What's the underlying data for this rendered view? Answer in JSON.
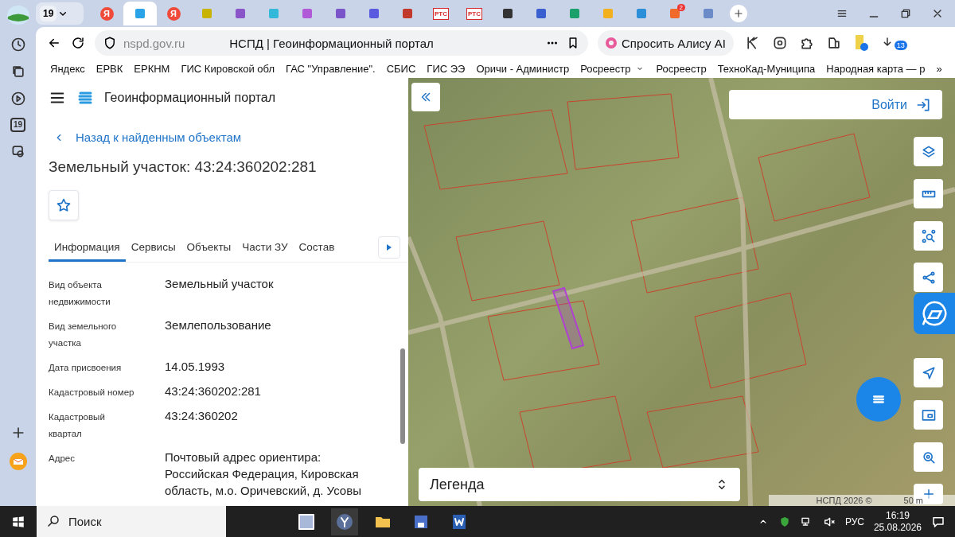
{
  "browser": {
    "group_counter": "19",
    "tabs": [
      {
        "kind": "yandex",
        "label": "Я",
        "selected": false
      },
      {
        "kind": "icon",
        "color": "#2aa3e8",
        "selected": true
      },
      {
        "kind": "yandex",
        "label": "Я",
        "selected": false
      },
      {
        "kind": "icon",
        "color": "#c8b400",
        "selected": false
      },
      {
        "kind": "icon",
        "color": "#8a55c9",
        "selected": false
      },
      {
        "kind": "icon",
        "color": "#32b8d8",
        "selected": false
      },
      {
        "kind": "icon",
        "color": "#b05ad8",
        "selected": false
      },
      {
        "kind": "icon",
        "color": "#7a55c9",
        "selected": false
      },
      {
        "kind": "icon",
        "color": "#5a5ae0",
        "selected": false
      },
      {
        "kind": "icon",
        "color": "#c0392b",
        "selected": false
      },
      {
        "kind": "rts",
        "label": "РТС",
        "selected": false
      },
      {
        "kind": "rts",
        "label": "РТС",
        "selected": false
      },
      {
        "kind": "icon",
        "color": "#333333",
        "selected": false
      },
      {
        "kind": "icon",
        "color": "#3a5fcf",
        "selected": false
      },
      {
        "kind": "icon",
        "color": "#1aa06a",
        "selected": false
      },
      {
        "kind": "icon",
        "color": "#f2b01e",
        "selected": false
      },
      {
        "kind": "icon",
        "color": "#2a8fd8",
        "selected": false
      },
      {
        "kind": "icon",
        "color": "#f06a2a",
        "badge": "2",
        "selected": false
      },
      {
        "kind": "icon",
        "color": "#6a8ac8",
        "selected": false
      }
    ],
    "address": "nspd.gov.ru",
    "page_title": "НСПД | Геоинформационный портал",
    "alice_button": "Спросить Алису AI",
    "downloads_badge": "13",
    "sidebar_calendar": "19",
    "bookmarks": [
      {
        "label": "Яндекс",
        "dropdown": false
      },
      {
        "label": "ЕРВК",
        "dropdown": false
      },
      {
        "label": "ЕРКНМ",
        "dropdown": false
      },
      {
        "label": "ГИС Кировской обл",
        "dropdown": false
      },
      {
        "label": "ГАС \"Управление\".",
        "dropdown": false
      },
      {
        "label": "СБИС",
        "dropdown": false
      },
      {
        "label": "ГИС ЭЭ",
        "dropdown": false
      },
      {
        "label": "Оричи - Администр",
        "dropdown": false
      },
      {
        "label": "Росреестр",
        "dropdown": true
      },
      {
        "label": "Росреестр",
        "dropdown": false
      },
      {
        "label": "ТехноКад-Муниципа",
        "dropdown": false
      },
      {
        "label": "Народная карта — р",
        "dropdown": false
      }
    ],
    "bookmarks_more": "»"
  },
  "panel": {
    "portal_title": "Геоинформационный портал",
    "back_link": "Назад к найденным объектам",
    "title": "Земельный участок: 43:24:360202:281",
    "tabs": [
      {
        "label": "Информация",
        "selected": true
      },
      {
        "label": "Сервисы",
        "selected": false
      },
      {
        "label": "Объекты",
        "selected": false
      },
      {
        "label": "Части ЗУ",
        "selected": false
      },
      {
        "label": "Состав",
        "selected": false
      }
    ],
    "fields": [
      {
        "label": "Вид объекта недвижимости",
        "value": "Земельный участок"
      },
      {
        "label": "Вид земельного участка",
        "value": "Землепользование"
      },
      {
        "label": "Дата присвоения",
        "value": "14.05.1993"
      },
      {
        "label": "Кадастровый номер",
        "value": "43:24:360202:281"
      },
      {
        "label": "Кадастровый квартал",
        "value": "43:24:360202"
      },
      {
        "label": "Адрес",
        "value": "Почтовый адрес ориентира: Российская Федерация, Кировская область, м.о. Оричевский, д. Усовы"
      }
    ]
  },
  "map": {
    "login_button": "Войти",
    "legend": "Легенда",
    "attribution": "НСПД 2026 ©",
    "scale": "50 m"
  },
  "taskbar": {
    "search_placeholder": "Поиск",
    "language": "РУС",
    "time": "16:19",
    "date": "25.08.2026"
  }
}
